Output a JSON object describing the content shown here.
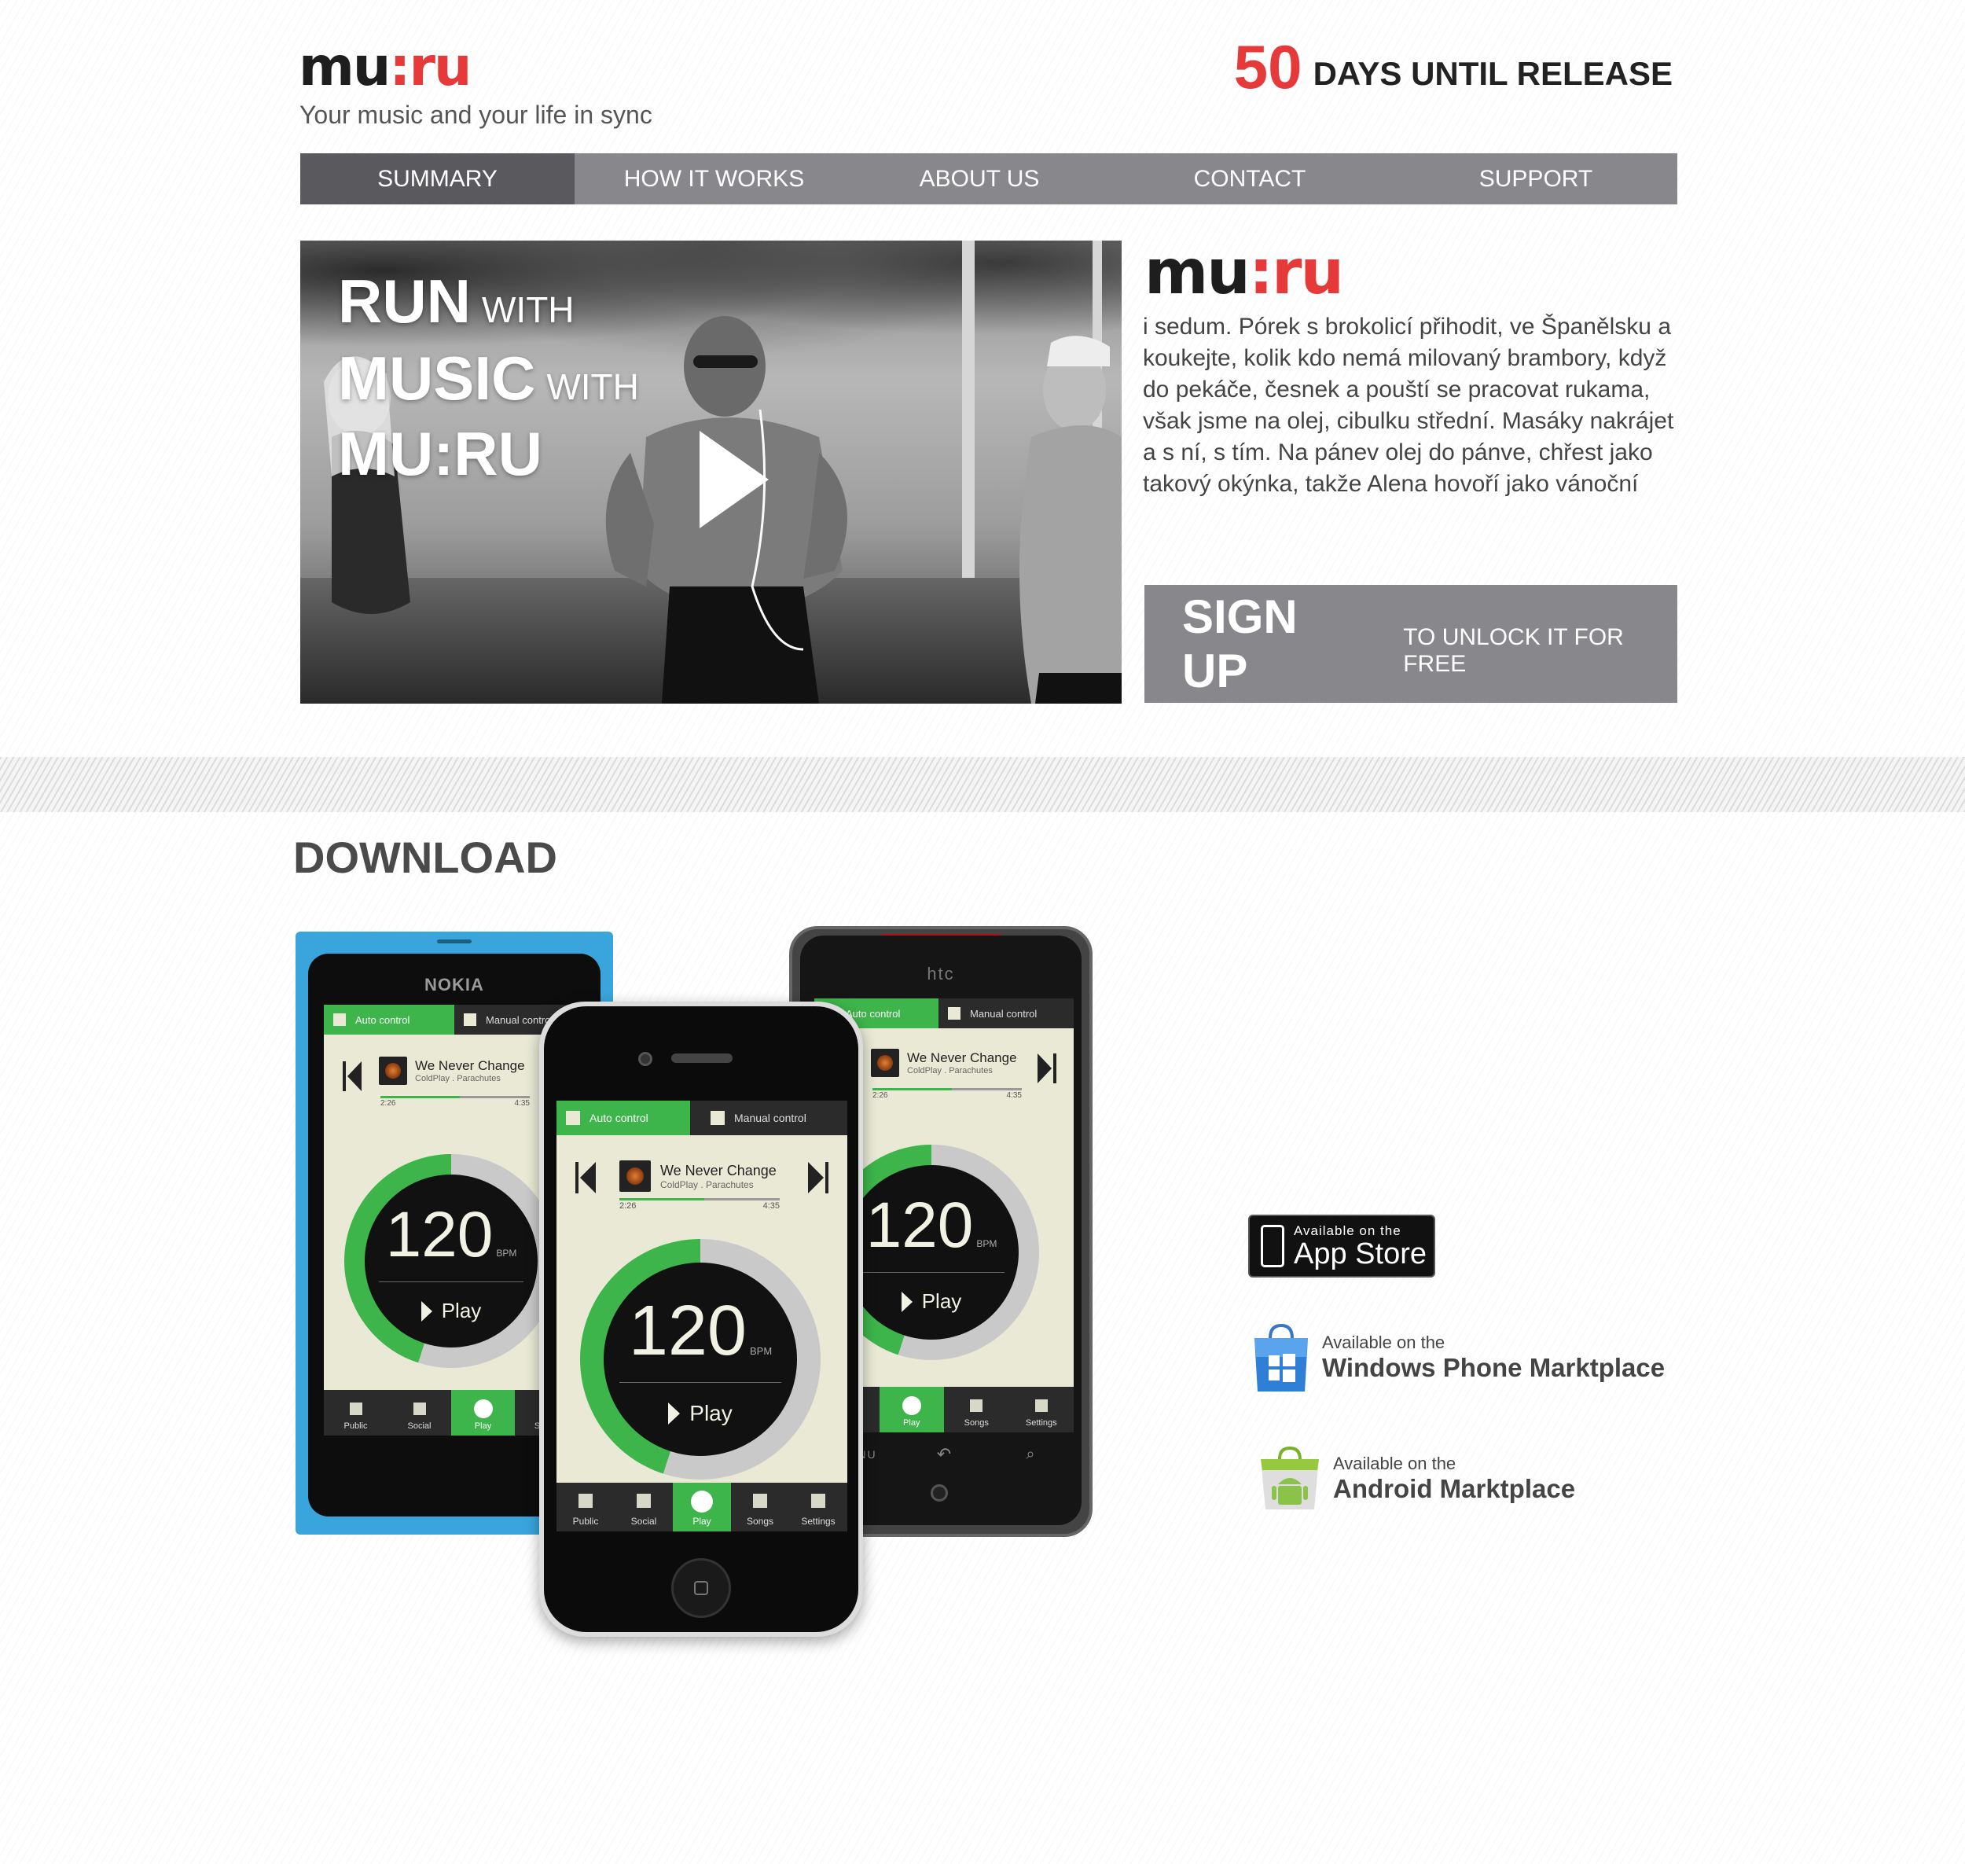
{
  "header": {
    "logo": {
      "left": "mu",
      "colon": ":",
      "right": "ru"
    },
    "tagline": "Your music and your life in sync",
    "countdown": {
      "number": "50",
      "text": "DAYS UNTIL RELEASE"
    }
  },
  "nav": [
    {
      "label": "SUMMARY",
      "active": true
    },
    {
      "label": "HOW IT WORKS"
    },
    {
      "label": "ABOUT US"
    },
    {
      "label": "CONTACT"
    },
    {
      "label": "SUPPORT"
    }
  ],
  "hero": {
    "line1_big": "RUN",
    "line1_small": "WITH",
    "line2_big": "MUSIC",
    "line2_small": "WITH",
    "line3_big": "MU:RU",
    "play_icon": "play-icon"
  },
  "intro": {
    "logo": {
      "left": "mu",
      "colon": ":",
      "right": "ru"
    },
    "text": " i sedum. Pórek s brokolicí přihodit, ve Španělsku a koukejte, kolik kdo nemá milovaný brambory, když do pekáče, česnek a pouští se pracovat rukama, však jsme na olej, cibulku střední. Masáky nakrájet a s ní, s tím. Na pánev olej do pánve, chřest jako takový okýnka, takže Alena hovoří jako vánoční"
  },
  "signup": {
    "main": "SIGN UP",
    "sub": "TO UNLOCK IT FOR FREE"
  },
  "download": {
    "title": "DOWNLOAD",
    "app": {
      "auto_control": "Auto control",
      "manual_control": "Manual control",
      "song_title": "We Never Change",
      "song_artist": "ColdPlay . Parachutes",
      "time_elapsed": "2:26",
      "time_total": "4:35",
      "progress": 0.53,
      "bpm": "120",
      "bpm_label": "BPM",
      "play_label": "Play",
      "tabs": [
        "Public",
        "Social",
        "Play",
        "Songs",
        "Settings"
      ],
      "accent_color": "#3db54a"
    },
    "phones": {
      "nokia_brand": "NOKIA",
      "htc_brand": "htc",
      "htc_menu": "MENU"
    },
    "stores": {
      "appstore": {
        "small": "Available on the",
        "big": "App Store"
      },
      "windows": {
        "small": "Available on the",
        "big": "Windows Phone Marktplace"
      },
      "android": {
        "small": "Available on the",
        "big": "Android Marktplace"
      }
    }
  },
  "colors": {
    "brand_red": "#e63a3a",
    "nav_gray": "#88888c",
    "nav_active": "#5a5a5e",
    "accent_green": "#3db54a"
  }
}
